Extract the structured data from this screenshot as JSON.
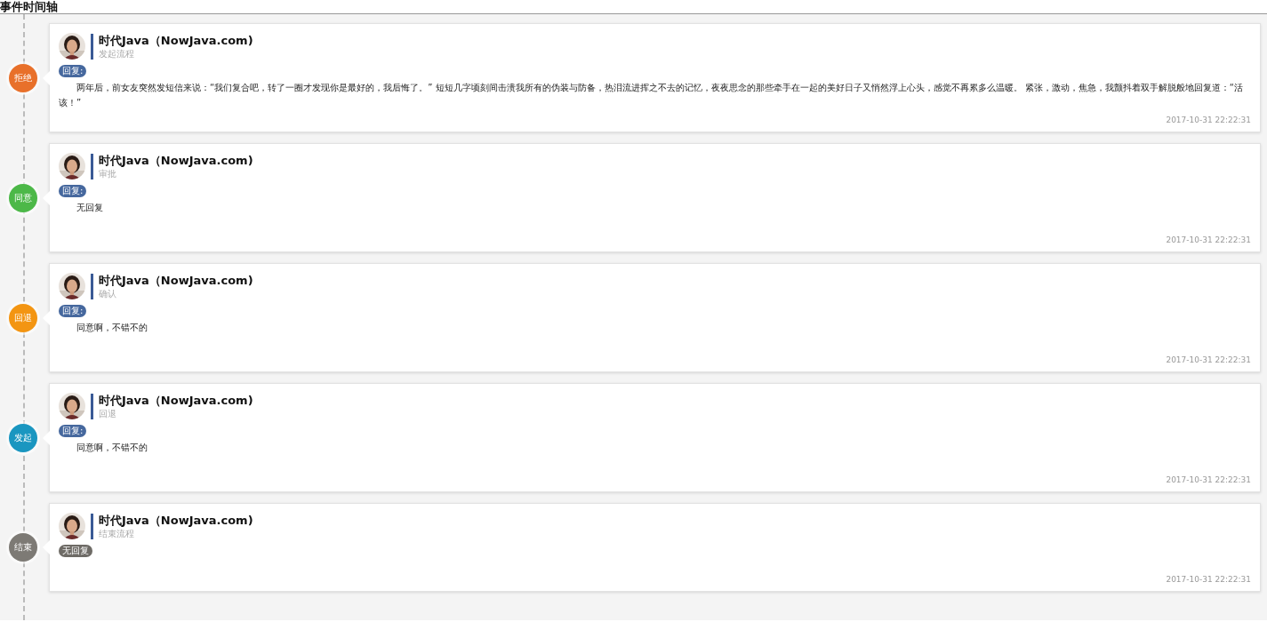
{
  "title": "事件时间轴",
  "events": [
    {
      "node": "拒绝",
      "color": "#e8702a",
      "name": "时代Java（NowJava.com)",
      "role": "发起流程",
      "tag": {
        "kind": "reply",
        "label": "回复:"
      },
      "body": "两年后，前女友突然发短信来说：“我们复合吧，转了一圈才发现你是最好的，我后悔了。” 短短几字顷刻间击溃我所有的伪装与防备，热泪流进挥之不去的记忆，夜夜思念的那些牵手在一起的美好日子又悄然浮上心头，感觉不再累多么温暖。 紧张，激动，焦急，我颤抖着双手解脱般地回复道：“活该！”",
      "time": "2017-10-31 22:22:31"
    },
    {
      "node": "同意",
      "color": "#4cb848",
      "name": "时代Java（NowJava.com)",
      "role": "审批",
      "tag": {
        "kind": "reply",
        "label": "回复:"
      },
      "body": "无回复",
      "time": "2017-10-31 22:22:31"
    },
    {
      "node": "回退",
      "color": "#f39512",
      "name": "时代Java（NowJava.com)",
      "role": "确认",
      "tag": {
        "kind": "reply",
        "label": "回复:"
      },
      "body": "同意啊，不错不的",
      "time": "2017-10-31 22:22:31"
    },
    {
      "node": "发起",
      "color": "#1a96c0",
      "name": "时代Java（NowJava.com)",
      "role": "回退",
      "tag": {
        "kind": "reply",
        "label": "回复:"
      },
      "body": "同意啊，不错不的",
      "time": "2017-10-31 22:22:31"
    },
    {
      "node": "结束",
      "color": "#7d7a75",
      "name": "时代Java（NowJava.com)",
      "role": "结束流程",
      "tag": {
        "kind": "none",
        "label": "无回复"
      },
      "time": "2017-10-31 22:22:31"
    }
  ]
}
